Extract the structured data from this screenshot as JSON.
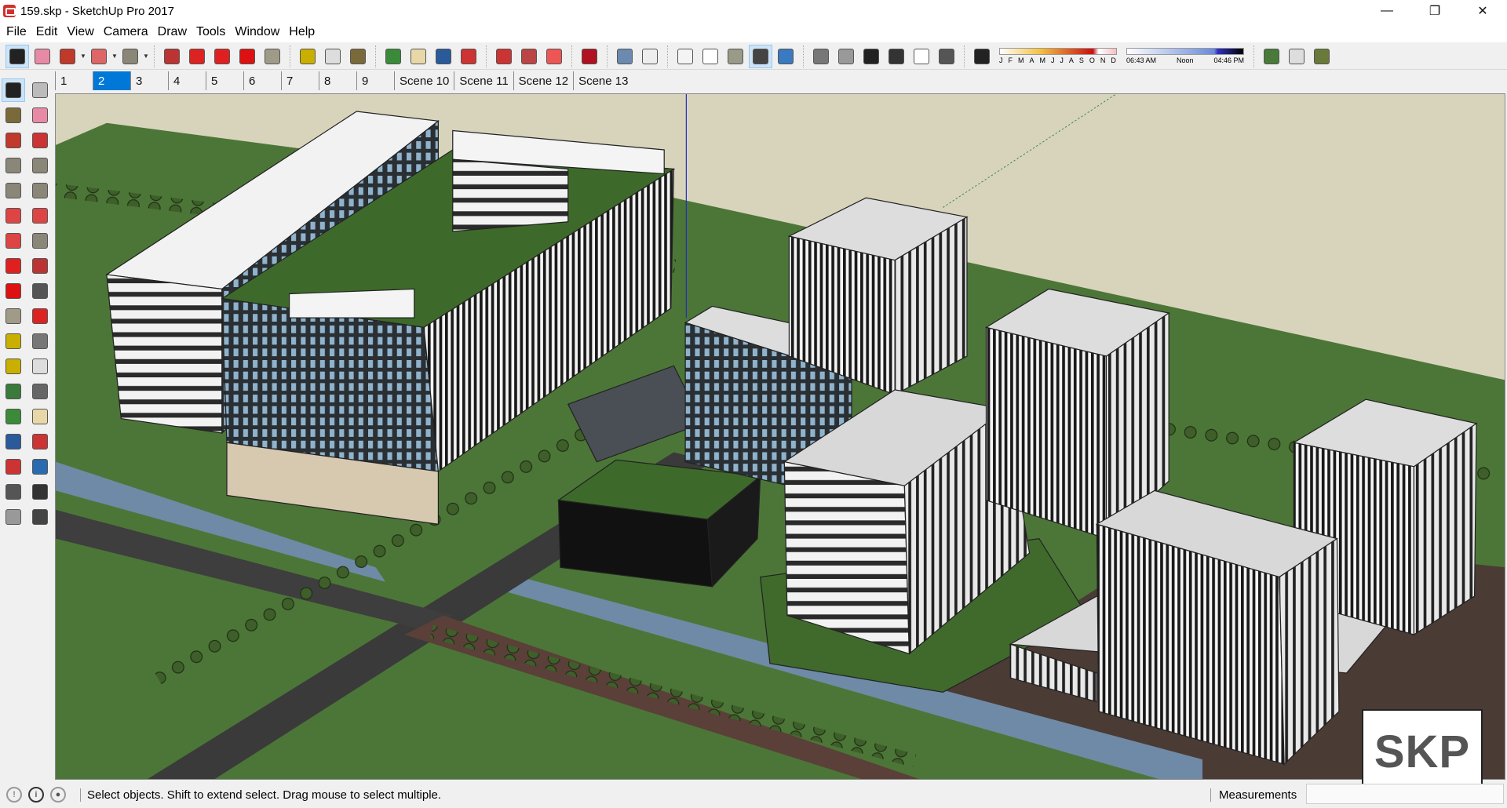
{
  "window": {
    "title": "159.skp - SketchUp Pro 2017",
    "minimize": "—",
    "maximize": "❐",
    "close": "✕"
  },
  "menu": [
    "File",
    "Edit",
    "View",
    "Camera",
    "Draw",
    "Tools",
    "Window",
    "Help"
  ],
  "toolbar": [
    {
      "name": "select-icon",
      "color": "#222",
      "active": true
    },
    {
      "name": "eraser-icon",
      "color": "#e88aa6"
    },
    {
      "name": "pencil-line-icon",
      "color": "#c0392b",
      "dd": true
    },
    {
      "name": "polygon-arc-icon",
      "color": "#d66",
      "dd": true
    },
    {
      "name": "rectangle-icon",
      "color": "#8a8678",
      "dd": true
    },
    "sep",
    {
      "name": "push-pull-icon",
      "color": "#b33"
    },
    {
      "name": "follow-me-icon",
      "color": "#d22"
    },
    {
      "name": "move-icon",
      "color": "#e02020"
    },
    {
      "name": "rotate-icon",
      "color": "#d11"
    },
    {
      "name": "scale-icon",
      "color": "#a09a88"
    },
    "sep",
    {
      "name": "tape-measure-icon",
      "color": "#c9b000"
    },
    {
      "name": "text-icon",
      "color": "#ddd"
    },
    {
      "name": "paint-bucket-icon",
      "color": "#7a6a3a"
    },
    "sep",
    {
      "name": "orbit-icon",
      "color": "#3a8a3a"
    },
    {
      "name": "pan-icon",
      "color": "#e8d8a8"
    },
    {
      "name": "zoom-icon",
      "color": "#2a5a9a"
    },
    {
      "name": "zoom-extents-icon",
      "color": "#c33"
    },
    "sep",
    {
      "name": "3d-warehouse-icon",
      "color": "#c33"
    },
    {
      "name": "extension-warehouse-icon",
      "color": "#b44"
    },
    {
      "name": "send-to-layout-icon",
      "color": "#e55"
    },
    "sep",
    {
      "name": "ruby-console-icon",
      "color": "#b01020"
    },
    "sep",
    {
      "name": "xray-icon",
      "color": "#6a8ab0"
    },
    {
      "name": "back-edges-icon",
      "color": "#eee"
    },
    "sep",
    {
      "name": "wireframe-icon",
      "color": "#f4f4f4"
    },
    {
      "name": "hidden-line-icon",
      "color": "#fff"
    },
    {
      "name": "shaded-icon",
      "color": "#9a9a88"
    },
    {
      "name": "shaded-with-textures-icon",
      "color": "#444",
      "active": true
    },
    {
      "name": "monochrome-icon",
      "color": "#3a7ac0"
    },
    "sep",
    {
      "name": "iso-view-icon",
      "color": "#777"
    },
    {
      "name": "top-view-icon",
      "color": "#999"
    },
    {
      "name": "front-view-icon",
      "color": "#222"
    },
    {
      "name": "right-view-icon",
      "color": "#333"
    },
    {
      "name": "back-view-icon",
      "color": "#fff"
    },
    {
      "name": "left-view-icon",
      "color": "#555"
    },
    "sep",
    {
      "name": "shadows-toggle-icon",
      "color": "#222"
    },
    "slider-date",
    "slider-time",
    "sep",
    {
      "name": "add-location-icon",
      "color": "#4a7a3a"
    },
    {
      "name": "show-terrain-icon",
      "color": "#ddd"
    },
    {
      "name": "photo-textures-icon",
      "color": "#6a7a3a"
    }
  ],
  "shadows": {
    "months": [
      "J",
      "F",
      "M",
      "A",
      "M",
      "J",
      "J",
      "A",
      "S",
      "O",
      "N",
      "D"
    ],
    "date_fraction": 0.84,
    "time_start": "06:43 AM",
    "time_mid": "Noon",
    "time_end": "04:46 PM",
    "time_fraction": 0.75
  },
  "scenes": [
    {
      "label": "1"
    },
    {
      "label": "2",
      "selected": true
    },
    {
      "label": "3"
    },
    {
      "label": "4"
    },
    {
      "label": "5"
    },
    {
      "label": "6"
    },
    {
      "label": "7"
    },
    {
      "label": "8"
    },
    {
      "label": "9"
    },
    {
      "label": "Scene 10"
    },
    {
      "label": "Scene 11"
    },
    {
      "label": "Scene 12"
    },
    {
      "label": "Scene 13"
    }
  ],
  "left_tools": [
    {
      "name": "select-icon",
      "color": "#222",
      "active": true
    },
    {
      "name": "make-component-icon",
      "color": "#bbb"
    },
    {
      "name": "paint-bucket-icon",
      "color": "#7a6a3a"
    },
    {
      "name": "eraser-icon",
      "color": "#e88aa6"
    },
    {
      "name": "line-icon",
      "color": "#c0392b"
    },
    {
      "name": "freehand-icon",
      "color": "#c33"
    },
    {
      "name": "rectangle-icon",
      "color": "#8a8678"
    },
    {
      "name": "rotated-rectangle-icon",
      "color": "#8a8678"
    },
    {
      "name": "circle-icon",
      "color": "#8a8678"
    },
    {
      "name": "polygon-icon",
      "color": "#8a8678"
    },
    {
      "name": "arc-icon",
      "color": "#d44"
    },
    {
      "name": "two-point-arc-icon",
      "color": "#d44"
    },
    {
      "name": "three-point-arc-icon",
      "color": "#d44"
    },
    {
      "name": "pie-icon",
      "color": "#8a8678"
    },
    {
      "name": "move-icon",
      "color": "#e02020"
    },
    {
      "name": "push-pull-icon",
      "color": "#b33"
    },
    {
      "name": "rotate-icon",
      "color": "#d11"
    },
    {
      "name": "follow-me-icon",
      "color": "#555"
    },
    {
      "name": "scale-icon",
      "color": "#a09a88"
    },
    {
      "name": "offset-icon",
      "color": "#d22"
    },
    {
      "name": "tape-measure-icon",
      "color": "#c9b000"
    },
    {
      "name": "dimension-icon",
      "color": "#777"
    },
    {
      "name": "protractor-icon",
      "color": "#c9b000"
    },
    {
      "name": "text-icon",
      "color": "#ddd"
    },
    {
      "name": "axes-icon",
      "color": "#3a7a3a"
    },
    {
      "name": "3d-text-icon",
      "color": "#666"
    },
    {
      "name": "orbit-icon",
      "color": "#3a8a3a"
    },
    {
      "name": "pan-icon",
      "color": "#e8d8a8"
    },
    {
      "name": "zoom-icon",
      "color": "#2a5a9a"
    },
    {
      "name": "zoom-window-icon",
      "color": "#c33"
    },
    {
      "name": "zoom-extents-icon",
      "color": "#c33"
    },
    {
      "name": "previous-view-icon",
      "color": "#2a6ab0"
    },
    {
      "name": "position-camera-icon",
      "color": "#555"
    },
    {
      "name": "look-around-icon",
      "color": "#333"
    },
    {
      "name": "walk-icon",
      "color": "#999"
    },
    {
      "name": "section-plane-icon",
      "color": "#444"
    }
  ],
  "status": {
    "text": "Select objects. Shift to extend select. Drag mouse to select multiple.",
    "measurements_label": "Measurements",
    "measurements_value": ""
  },
  "watermark": "SKP"
}
